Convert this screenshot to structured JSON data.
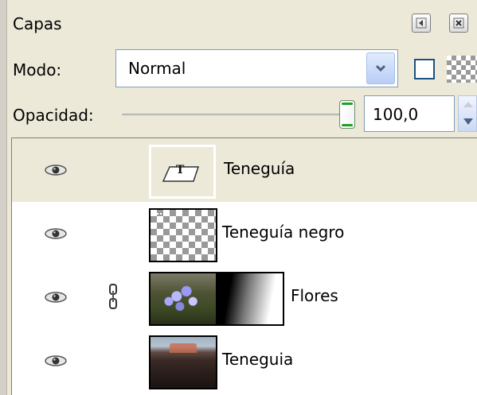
{
  "panel": {
    "title": "Capas",
    "mode_label": "Modo:",
    "mode_value": "Normal",
    "opacity_label": "Opacidad:",
    "opacity_value": "100,0",
    "opacity_percent": 100
  },
  "layers": [
    {
      "name": "Teneguía",
      "visible": true,
      "linked": false,
      "thumbnail": "text-layer-icon",
      "selected": true
    },
    {
      "name": "Teneguía negro",
      "visible": true,
      "linked": false,
      "thumbnail": "transparent-layer",
      "selected": false
    },
    {
      "name": "Flores",
      "visible": true,
      "linked": true,
      "thumbnail": "photo-with-mask",
      "selected": false
    },
    {
      "name": "Teneguia",
      "visible": true,
      "linked": false,
      "thumbnail": "photo",
      "selected": false
    }
  ],
  "colors": {
    "panel_background": "#ece9d8",
    "selected_row": "#ece9d8",
    "slider_handle_accent": "#21a121",
    "input_border": "#7f9db9"
  }
}
